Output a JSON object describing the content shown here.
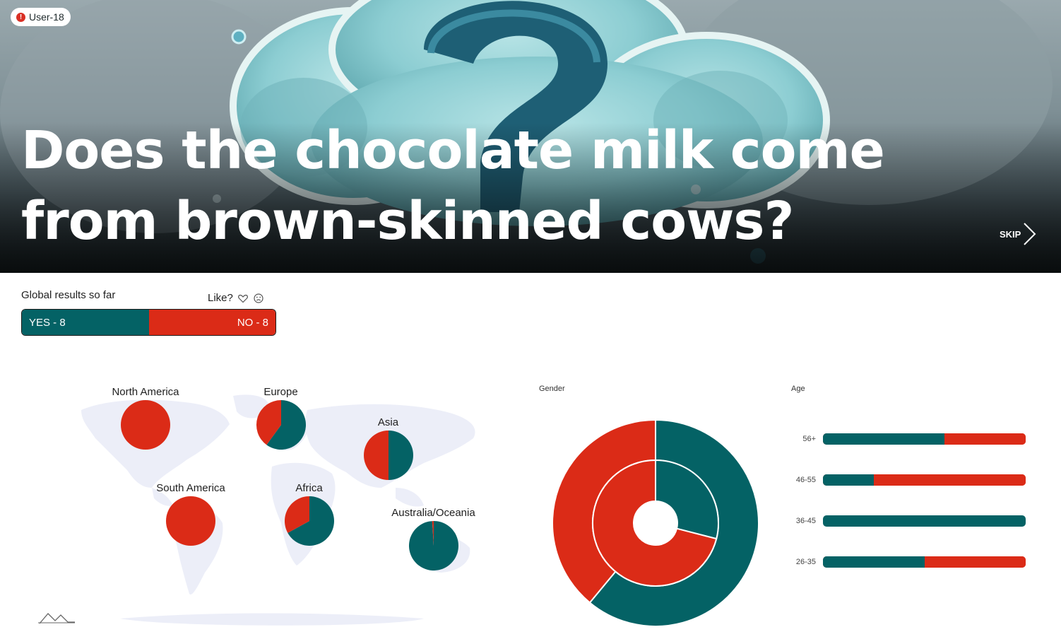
{
  "user": {
    "label": "User-18",
    "badge": "!"
  },
  "question": "Does the chocolate milk come from brown-skinned cows?",
  "skip_label": "SKIP",
  "results": {
    "title": "Global results so far",
    "like_label": "Like?",
    "yes_label": "YES - 8",
    "no_label": "NO - 8",
    "yes_count": 8,
    "no_count": 8
  },
  "colors": {
    "yes": "#046265",
    "no": "#db2b17",
    "map": "#eceef8"
  },
  "icons": {
    "like": "heart-icon",
    "dislike": "frown-icon",
    "skip": "chevron-right-icon",
    "logo": "mountain-logo-icon"
  },
  "chart_data": [
    {
      "type": "pie",
      "name": "regions",
      "series_names": [
        "YES",
        "NO"
      ],
      "regions": [
        {
          "label": "North America",
          "yes": 0.0,
          "no": 1.0
        },
        {
          "label": "Europe",
          "yes": 0.6,
          "no": 0.4
        },
        {
          "label": "Asia",
          "yes": 0.5,
          "no": 0.5
        },
        {
          "label": "South America",
          "yes": 0.0,
          "no": 1.0
        },
        {
          "label": "Africa",
          "yes": 0.67,
          "no": 0.33
        },
        {
          "label": "Australia/Oceania",
          "yes": 0.99,
          "no": 0.01
        }
      ]
    },
    {
      "type": "pie",
      "name": "gender",
      "title": "Gender",
      "rings": [
        {
          "ring": "outer",
          "yes": 0.61,
          "no": 0.39
        },
        {
          "ring": "inner",
          "yes": 0.29,
          "no": 0.71
        }
      ]
    },
    {
      "type": "bar",
      "name": "age",
      "title": "Age",
      "categories": [
        "56+",
        "46-55",
        "36-45",
        "26-35"
      ],
      "series": [
        {
          "name": "YES",
          "values": [
            0.6,
            0.25,
            1.0,
            0.5
          ]
        },
        {
          "name": "NO",
          "values": [
            0.4,
            0.75,
            0.0,
            0.5
          ]
        }
      ]
    }
  ]
}
